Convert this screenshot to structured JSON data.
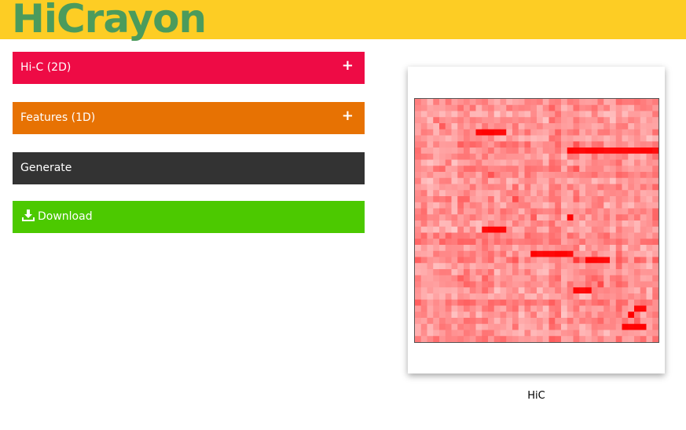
{
  "header": {
    "logo_text": "HiCrayon",
    "bg_color": "#fdcd24",
    "logo_color": "#4b9b5c"
  },
  "panels": {
    "hic": {
      "label": "Hi-C (2D)",
      "color": "#ee0b45",
      "expand_glyph": "+"
    },
    "features": {
      "label": "Features (1D)",
      "color": "#e77203",
      "expand_glyph": "+"
    },
    "generate": {
      "label": "Generate",
      "color": "#333333"
    },
    "download": {
      "label": "Download",
      "color": "#4cc900",
      "icon": "download-icon"
    }
  },
  "figure": {
    "caption": "HiC",
    "colormap": {
      "low": "#ffffff",
      "high": "#ff0000"
    }
  }
}
